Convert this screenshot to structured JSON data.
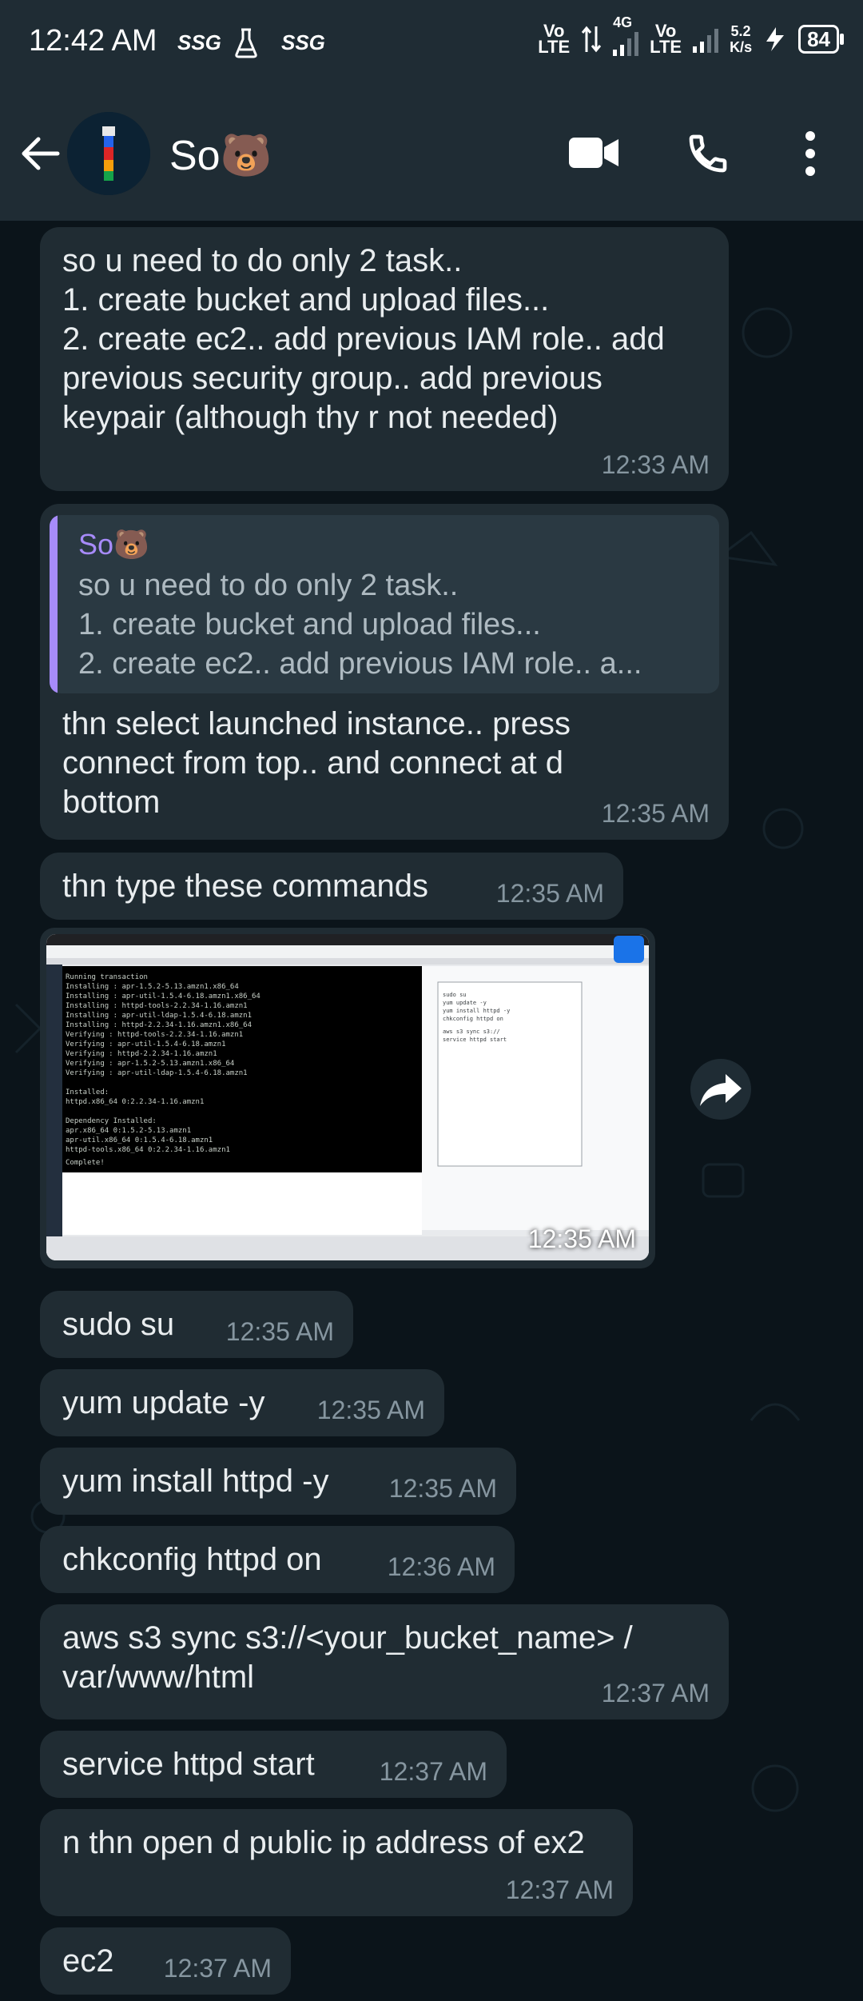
{
  "status_bar": {
    "time": "12:42 AM",
    "app1": "SSG",
    "app2": "SSG",
    "net1": "Vo\nLTE",
    "net_type": "4G",
    "net2": "Vo\nLTE",
    "speed_value": "5.2",
    "speed_unit": "K/s",
    "battery": "84"
  },
  "header": {
    "contact_name": "So🐻"
  },
  "messages": [
    {
      "text": "so u need to do only 2 task..\n1. create bucket and upload files...\n2. create ec2.. add previous IAM role.. add previous security group.. add previous keypair (although thy r not needed)",
      "time": "12:33 AM"
    },
    {
      "quote_name": "So🐻",
      "quote_text": "so u need to do only 2 task..\n1. create bucket and upload files...\n2. create ec2.. add previous IAM role.. a...",
      "text": "thn select launched instance.. press connect from top.. and connect at d bottom",
      "time": "12:35 AM"
    },
    {
      "text": "thn type these commands",
      "time": "12:35 AM"
    },
    {
      "image_time": "12:35 AM"
    },
    {
      "text": "sudo su",
      "time": "12:35 AM"
    },
    {
      "text": "yum update -y",
      "time": "12:35 AM"
    },
    {
      "text": "yum install httpd -y",
      "time": "12:35 AM"
    },
    {
      "text": "chkconfig httpd on",
      "time": "12:36 AM"
    },
    {
      "text": "aws s3 sync s3://<your_bucket_name> /\nvar/www/html",
      "time": "12:37 AM"
    },
    {
      "text": "service httpd start",
      "time": "12:37 AM"
    },
    {
      "text": "n thn open d public ip address of ex2",
      "time": "12:37 AM"
    },
    {
      "text": "ec2",
      "time": "12:37 AM"
    }
  ],
  "colors": {
    "background": "#0b141a",
    "bubble": "#202c33",
    "header": "#1f2c34",
    "quote_accent": "#a78bfa",
    "timestamp": "#8696a0"
  },
  "icons": [
    "back-arrow-icon",
    "video-call-icon",
    "phone-icon",
    "more-options-icon",
    "forward-icon"
  ]
}
